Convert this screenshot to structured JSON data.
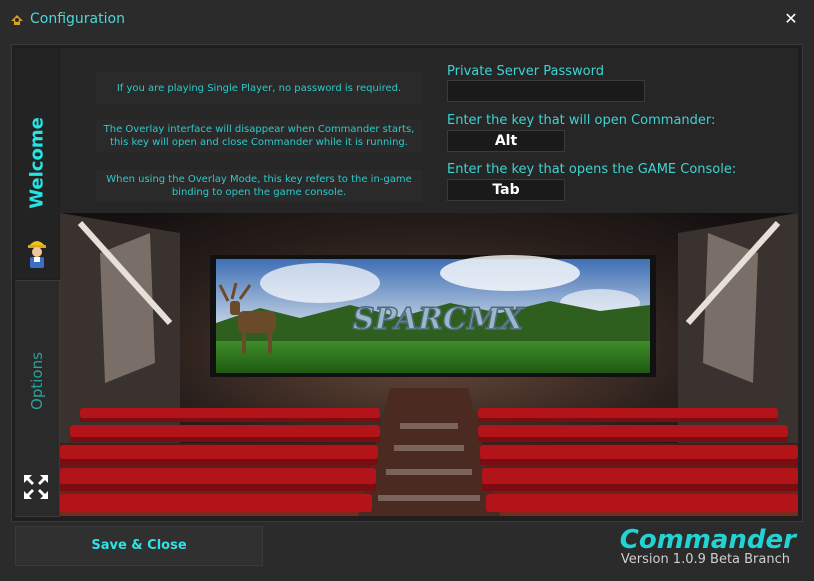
{
  "window": {
    "title": "Configuration",
    "close_icon": "close-icon",
    "app_icon": "commander-app-icon"
  },
  "tabs": [
    {
      "label": "Welcome",
      "icon": "worker-icon",
      "active": true
    },
    {
      "label": "Options",
      "icon": "arrows-icon",
      "active": false
    }
  ],
  "info_panels": [
    {
      "line1": "If you are playing Single Player, no password is required.",
      "line2": ""
    },
    {
      "line1": "The Overlay interface will disappear when Commander starts,",
      "line2": "this key will open and close Commander while it is running."
    },
    {
      "line1": "When using the Overlay Mode, this key refers to the in-game",
      "line2": "binding to open the game console."
    }
  ],
  "fields": {
    "password_label": "Private Server Password",
    "password_value": "",
    "open_key_label": "Enter the key that will open Commander:",
    "open_key_value": "Alt",
    "console_key_label": "Enter the key that opens the GAME Console:",
    "console_key_value": "Tab"
  },
  "scene": {
    "screen_logo": "SPARCMX"
  },
  "footer": {
    "save_label": "Save & Close",
    "brand": "Commander",
    "version": "Version 1.0.9 Beta Branch"
  },
  "colors": {
    "accent": "#22e6e6",
    "background": "#2b2b2b",
    "seat_red": "#b2141a"
  }
}
